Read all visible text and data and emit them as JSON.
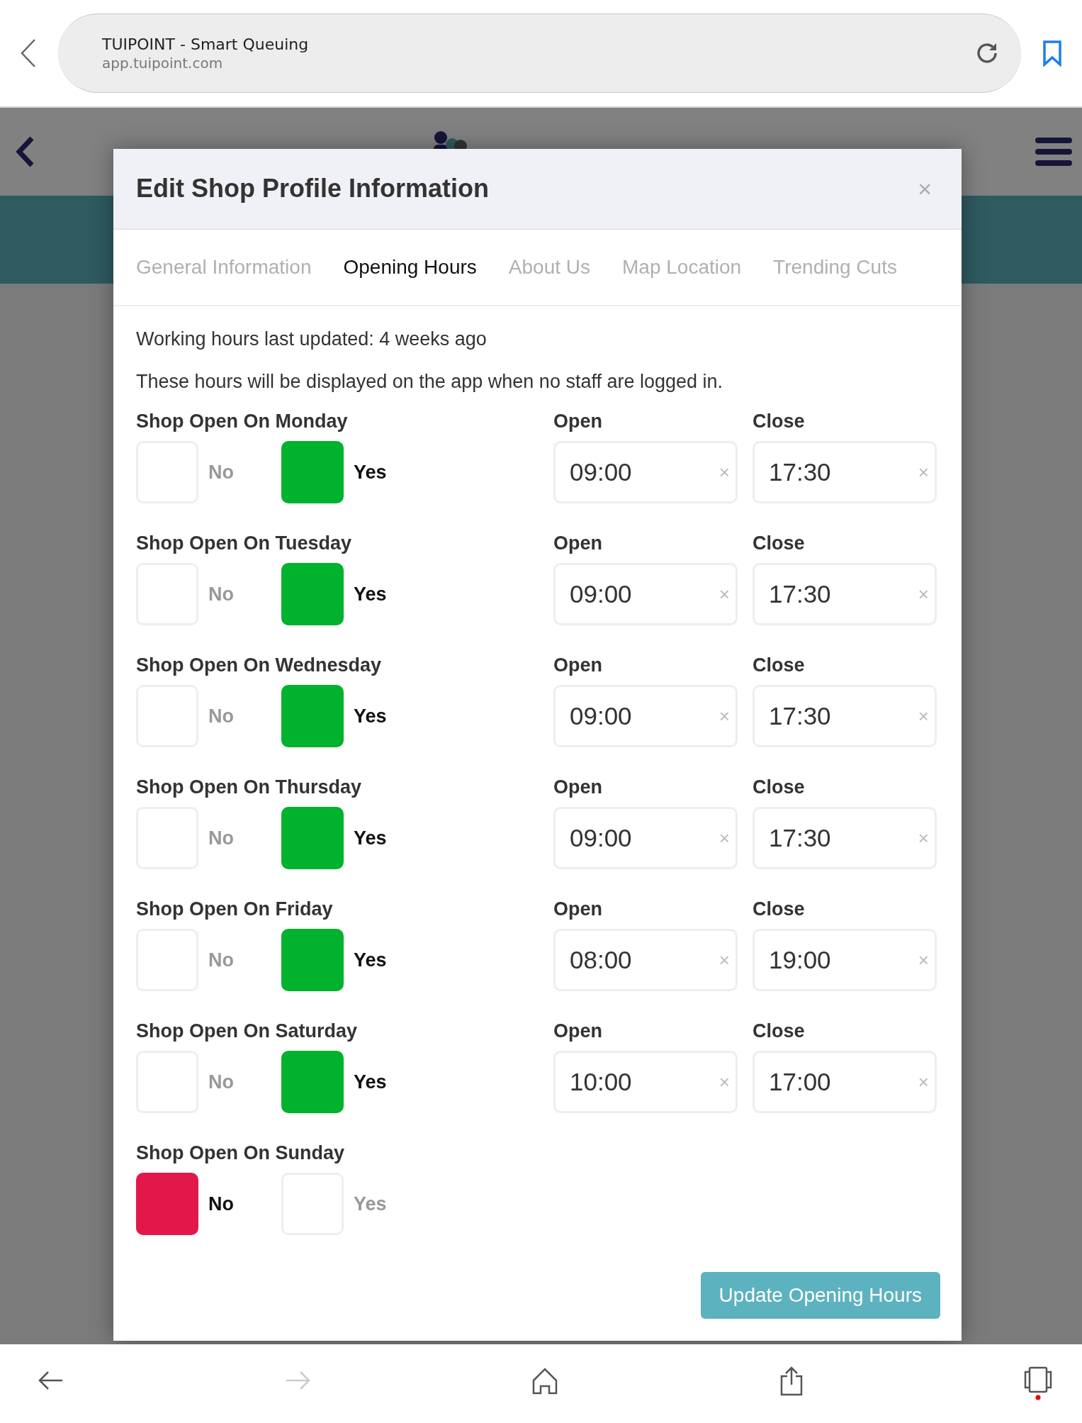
{
  "browser": {
    "title": "TUIPOINT - Smart Queuing",
    "url": "app.tuipoint.com"
  },
  "modal": {
    "title": "Edit Shop Profile Information",
    "close": "×",
    "tabs": [
      {
        "label": "General Information",
        "selected": false
      },
      {
        "label": "Opening Hours",
        "selected": true
      },
      {
        "label": "About Us",
        "selected": false
      },
      {
        "label": "Map Location",
        "selected": false
      },
      {
        "label": "Trending Cuts",
        "selected": false
      }
    ],
    "last_updated": "Working hours last updated: 4 weeks ago",
    "note": "These hours will be displayed on the app when no staff are logged in.",
    "days": [
      {
        "label": "Shop Open On Monday",
        "options": [
          {
            "kind": "no",
            "label": "No",
            "selected": false
          },
          {
            "kind": "yes",
            "label": "Yes",
            "selected": true
          }
        ],
        "fields": [
          {
            "label": "Open",
            "value": "09:00",
            "clear": "×"
          },
          {
            "label": "Close",
            "value": "17:30",
            "clear": "×"
          }
        ]
      },
      {
        "label": "Shop Open On Tuesday",
        "options": [
          {
            "kind": "no",
            "label": "No",
            "selected": false
          },
          {
            "kind": "yes",
            "label": "Yes",
            "selected": true
          }
        ],
        "fields": [
          {
            "label": "Open",
            "value": "09:00",
            "clear": "×"
          },
          {
            "label": "Close",
            "value": "17:30",
            "clear": "×"
          }
        ]
      },
      {
        "label": "Shop Open On Wednesday",
        "options": [
          {
            "kind": "no",
            "label": "No",
            "selected": false
          },
          {
            "kind": "yes",
            "label": "Yes",
            "selected": true
          }
        ],
        "fields": [
          {
            "label": "Open",
            "value": "09:00",
            "clear": "×"
          },
          {
            "label": "Close",
            "value": "17:30",
            "clear": "×"
          }
        ]
      },
      {
        "label": "Shop Open On Thursday",
        "options": [
          {
            "kind": "no",
            "label": "No",
            "selected": false
          },
          {
            "kind": "yes",
            "label": "Yes",
            "selected": true
          }
        ],
        "fields": [
          {
            "label": "Open",
            "value": "09:00",
            "clear": "×"
          },
          {
            "label": "Close",
            "value": "17:30",
            "clear": "×"
          }
        ]
      },
      {
        "label": "Shop Open On Friday",
        "options": [
          {
            "kind": "no",
            "label": "No",
            "selected": false
          },
          {
            "kind": "yes",
            "label": "Yes",
            "selected": true
          }
        ],
        "fields": [
          {
            "label": "Open",
            "value": "08:00",
            "clear": "×"
          },
          {
            "label": "Close",
            "value": "19:00",
            "clear": "×"
          }
        ]
      },
      {
        "label": "Shop Open On Saturday",
        "options": [
          {
            "kind": "no",
            "label": "No",
            "selected": false
          },
          {
            "kind": "yes",
            "label": "Yes",
            "selected": true
          }
        ],
        "fields": [
          {
            "label": "Open",
            "value": "10:00",
            "clear": "×"
          },
          {
            "label": "Close",
            "value": "17:00",
            "clear": "×"
          }
        ]
      },
      {
        "label": "Shop Open On Sunday",
        "options": [
          {
            "kind": "no",
            "label": "No",
            "selected": true
          },
          {
            "kind": "yes",
            "label": "Yes",
            "selected": false
          }
        ]
      }
    ],
    "button": "Update Opening Hours"
  },
  "toolbar": [
    {
      "kind": "back",
      "disabled": false
    },
    {
      "kind": "forward",
      "disabled": true
    },
    {
      "kind": "home",
      "disabled": false
    },
    {
      "kind": "share",
      "disabled": false
    },
    {
      "kind": "tabs",
      "disabled": false
    }
  ]
}
